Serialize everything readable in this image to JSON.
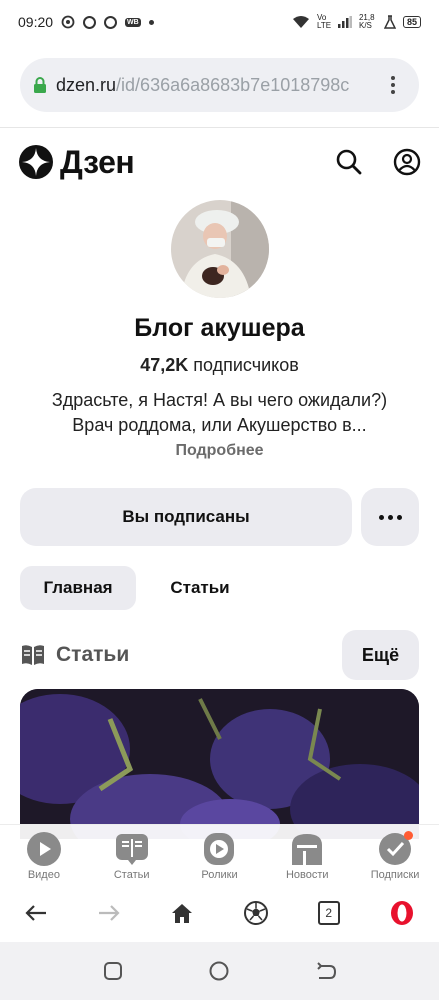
{
  "status_bar": {
    "time": "09:20",
    "wb_badge": "WB",
    "network": "Vo LTE",
    "speed": "21,8 K/S",
    "battery": "85"
  },
  "browser": {
    "url_domain": "dzen.ru",
    "url_path": "/id/636a6a8683b7e1018798c"
  },
  "zen": {
    "logo_text": "Дзен"
  },
  "profile": {
    "name": "Блог акушера",
    "subscribers_count": "47,2K",
    "subscribers_label": " подписчиков",
    "description_line1": "Здрасьте, я Настя! А вы чего ожидали?)",
    "description_line2": "Врач роддома, или Акушерство в...",
    "more_link": "Подробнее"
  },
  "actions": {
    "subscribed_label": "Вы подписаны"
  },
  "tabs": [
    {
      "label": "Главная",
      "active": true
    },
    {
      "label": "Статьи",
      "active": false
    }
  ],
  "section": {
    "title": "Статьи",
    "more_button": "Ещё"
  },
  "bottom_nav": [
    {
      "label": "Видео",
      "icon": "play-icon"
    },
    {
      "label": "Статьи",
      "icon": "book-icon"
    },
    {
      "label": "Ролики",
      "icon": "shorts-icon"
    },
    {
      "label": "Новости",
      "icon": "news-icon"
    },
    {
      "label": "Подписки",
      "icon": "subscriptions-icon"
    }
  ],
  "browser_toolbar": {
    "tab_count": "2"
  },
  "colors": {
    "accent_notification": "#ff5c33",
    "opera_red": "#e8112d",
    "chip_bg": "#ebebf0"
  }
}
